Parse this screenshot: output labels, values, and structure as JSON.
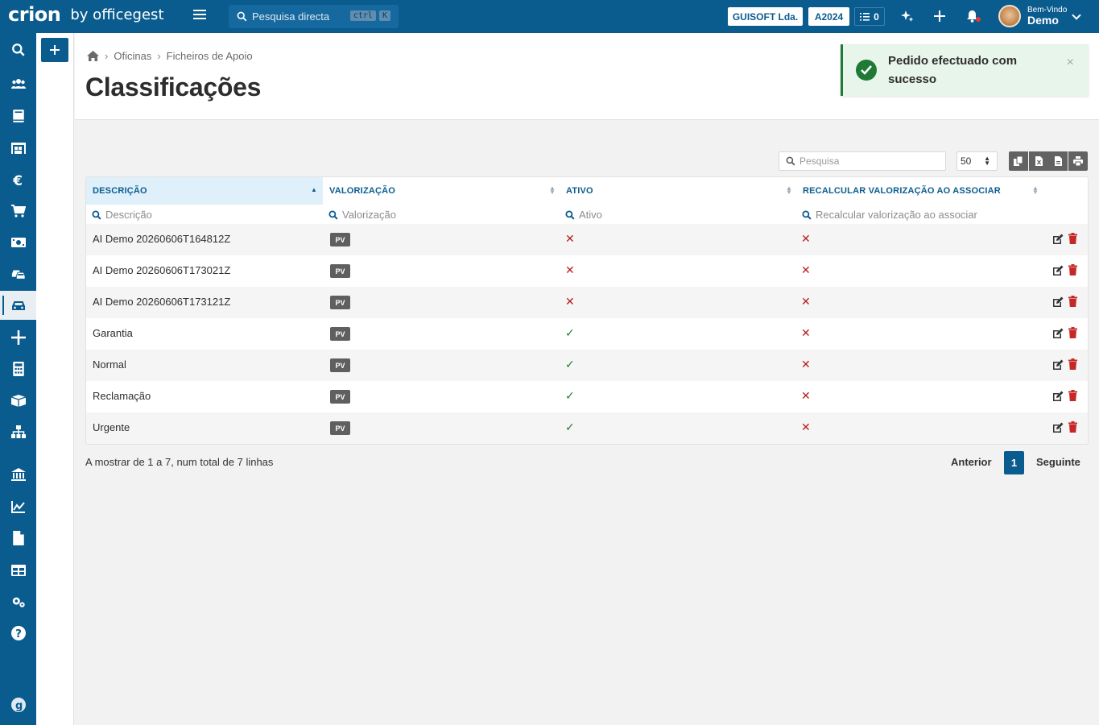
{
  "app": {
    "brand": "crion",
    "by": "by officegest"
  },
  "topbar": {
    "search_placeholder": "Pesquisa directa",
    "kbd1": "ctrl",
    "kbd2": "K",
    "company": "GUISOFT Lda.",
    "year": "A2024",
    "tasks_count": "0",
    "welcome": "Bem-Vindo",
    "user": "Demo"
  },
  "breadcrumb": {
    "items": [
      "Oficinas",
      "Ficheiros de Apoio"
    ]
  },
  "page_title": "Classificações",
  "toast": {
    "message": "Pedido efectuado com sucesso",
    "close": "×"
  },
  "toolbar": {
    "search_placeholder": "Pesquisa",
    "page_size": "50"
  },
  "table": {
    "headers": [
      "DESCRIÇÃO",
      "VALORIZAÇÃO",
      "ATIVO",
      "RECALCULAR VALORIZAÇÃO AO ASSOCIAR"
    ],
    "filters": [
      "Descrição",
      "Valorização",
      "Ativo",
      "Recalcular valorização ao associar"
    ],
    "rows": [
      {
        "descricao": "AI Demo 20260606T164812Z",
        "valorizacao": "PV",
        "ativo": false,
        "recalcular": false
      },
      {
        "descricao": "AI Demo 20260606T173021Z",
        "valorizacao": "PV",
        "ativo": false,
        "recalcular": false
      },
      {
        "descricao": "AI Demo 20260606T173121Z",
        "valorizacao": "PV",
        "ativo": false,
        "recalcular": false
      },
      {
        "descricao": "Garantia",
        "valorizacao": "PV",
        "ativo": true,
        "recalcular": false
      },
      {
        "descricao": "Normal",
        "valorizacao": "PV",
        "ativo": true,
        "recalcular": false
      },
      {
        "descricao": "Reclamação",
        "valorizacao": "PV",
        "ativo": true,
        "recalcular": false
      },
      {
        "descricao": "Urgente",
        "valorizacao": "PV",
        "ativo": true,
        "recalcular": false
      }
    ]
  },
  "footer": {
    "info": "A mostrar de 1 a 7, num total de 7 linhas",
    "prev": "Anterior",
    "current_page": "1",
    "next": "Seguinte"
  },
  "colors": {
    "primary": "#0a5c8f",
    "success": "#1f7a35",
    "danger": "#b71c1c"
  },
  "icons": {
    "sidebar": [
      "search-icon",
      "users-icon",
      "book-icon",
      "warehouse-icon",
      "euro-icon",
      "cart-icon",
      "money-icon",
      "cars-icon",
      "car-icon",
      "plus-icon",
      "calculator-icon",
      "box-icon",
      "sitemap-icon",
      "bank-icon",
      "chart-icon",
      "file-icon",
      "table-icon",
      "cogs-icon",
      "help-icon",
      "brand-g-icon"
    ]
  }
}
